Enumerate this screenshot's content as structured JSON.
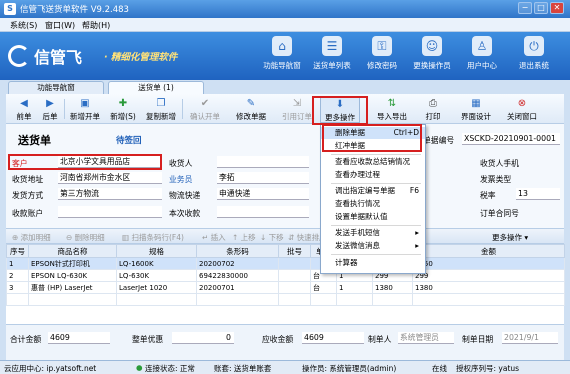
{
  "window": {
    "title": "信管飞送货单软件 V9.2.483",
    "min": "−",
    "max": "□",
    "close": "✕"
  },
  "menu": [
    {
      "label": "系统(S)"
    },
    {
      "label": "窗口(W)"
    },
    {
      "label": "帮助(H)"
    }
  ],
  "banner": {
    "logo": "信管飞",
    "slogan": "· 精细化管理软件",
    "buttons": [
      {
        "label": "功能导航窗",
        "icon": "⌂"
      },
      {
        "label": "送货单列表",
        "icon": "☰"
      },
      {
        "label": "修改密码",
        "icon": "⚿"
      },
      {
        "label": "更换操作员",
        "icon": "☺"
      },
      {
        "label": "用户中心",
        "icon": "♙"
      },
      {
        "label": "退出系统",
        "icon": "⏻"
      }
    ]
  },
  "tabs": [
    {
      "label": "功能导航窗"
    },
    {
      "label": "送货单 (1)"
    }
  ],
  "toolbar": [
    {
      "label": "前单",
      "icon": "◀"
    },
    {
      "label": "后单",
      "icon": "▶"
    },
    {
      "label": "新增开单",
      "icon": "▣"
    },
    {
      "label": "新增(S)",
      "icon": "✚"
    },
    {
      "label": "复制新增",
      "icon": "❐"
    },
    {
      "label": "确认开单",
      "icon": "✔"
    },
    {
      "label": "修改单据",
      "icon": "✎"
    },
    {
      "label": "引用订单",
      "icon": "⇲"
    },
    {
      "label": "更多操作",
      "icon": "⬇"
    },
    {
      "label": "导入导出",
      "icon": "⇅"
    },
    {
      "label": "打印",
      "icon": "⎙"
    },
    {
      "label": "界面设计",
      "icon": "▦"
    },
    {
      "label": "关闭窗口",
      "icon": "⊗"
    }
  ],
  "form": {
    "doc_title": "送货单",
    "doc_status": "待签回",
    "docno_label": "单据编号",
    "docno_value": "XSCKD-20210901-0001",
    "customer_label": "客户",
    "customer_value": "北京小学文具用品店",
    "receiver_label": "收货人",
    "receiver_phone_label": "收货人手机",
    "address_label": "收货地址",
    "address_value": "河南省郑州市金水区",
    "salesman_label": "业务员",
    "salesman_value": "李拓",
    "invoice_type_label": "发票类型",
    "ship_method_label": "发货方式",
    "ship_method_value": "第三方物流",
    "logistics_label": "物流快递",
    "logistics_value": "申通快递",
    "rate_label": "税率",
    "rate_value": "13",
    "account_label": "收款账户",
    "receive_label": "本次收款",
    "order_label": "订单合同号"
  },
  "gridbar": [
    {
      "label": "添加明细"
    },
    {
      "label": "删除明细"
    },
    {
      "label": "扫描条码行(F4)"
    },
    {
      "label": "插入"
    },
    {
      "label": "上移"
    },
    {
      "label": "下移"
    },
    {
      "label": "快速排序"
    },
    {
      "label": "更多操作"
    }
  ],
  "grid": {
    "headers": [
      "序号",
      "商品名称",
      "规格",
      "条形码",
      "批号",
      "单位",
      "数量",
      "单价",
      "金额"
    ],
    "rows": [
      {
        "no": "1",
        "name": "EPSON针式打印机",
        "spec": "LQ-1600K",
        "barcode": "20200702",
        "batch": "",
        "unit": "",
        "qty": "",
        "price": "",
        "amount": "2750"
      },
      {
        "no": "2",
        "name": "EPSON LQ-630K",
        "spec": "LQ-630K",
        "barcode": "69422830000",
        "batch": "",
        "unit": "台",
        "qty": "1",
        "price": "299",
        "amount": "299"
      },
      {
        "no": "3",
        "name": "惠普 (HP) LaserJet",
        "spec": "LaserJet 1020",
        "barcode": "20200701",
        "batch": "",
        "unit": "台",
        "qty": "1",
        "price": "1380",
        "amount": "1380"
      }
    ]
  },
  "footer": {
    "total_label": "合计金额",
    "total_value": "4609",
    "discount_label": "整单优惠",
    "discount_value": "0",
    "receivable_label": "应收金额",
    "receivable_value": "4609",
    "maker_label": "制单人",
    "maker_value": "系统管理员",
    "date_label": "制单日期",
    "date_value": "2021/9/1"
  },
  "status": {
    "cloud": "云应用中心: ip.yatsoft.net",
    "connection": "连接状态: 正常",
    "account": "账套: 送货单账套",
    "operator": "操作员: 系统管理员(admin)",
    "status": "在线",
    "license": "授权序列号: yatus"
  },
  "popup": [
    {
      "label": "删除单据",
      "shortcut": "Ctrl+D"
    },
    {
      "label": "红冲单据"
    },
    {
      "label": "查看应收款总结销情况"
    },
    {
      "label": "查看办理过程"
    },
    {
      "label": "调出指定编号单据",
      "shortcut": "F6"
    },
    {
      "label": "查看执行情况"
    },
    {
      "label": "设置单据默认值"
    },
    {
      "label": "发送手机短信"
    },
    {
      "label": "发送微信消息"
    },
    {
      "label": "计算器"
    }
  ],
  "colors": {
    "accent": "#2f74c8",
    "highlight": "#d61f1f",
    "link": "#1f5fb8"
  }
}
